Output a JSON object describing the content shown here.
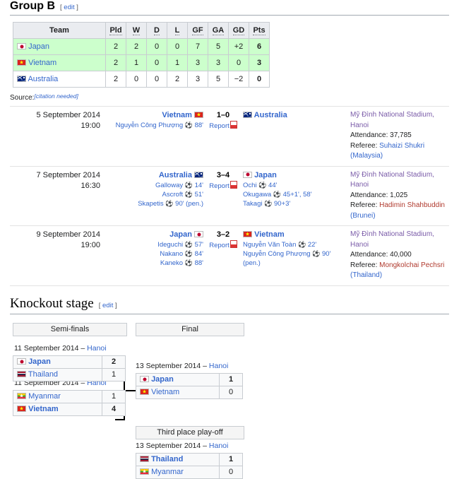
{
  "group": {
    "heading": "Group B",
    "edit": "[ edit ]",
    "edit_label": "edit",
    "columns": [
      "Team",
      "Pld",
      "W",
      "D",
      "L",
      "GF",
      "GA",
      "GD",
      "Pts"
    ],
    "rows": [
      {
        "team": "Japan",
        "flag": "jp",
        "pld": "2",
        "w": "2",
        "d": "0",
        "l": "0",
        "gf": "7",
        "ga": "5",
        "gd": "+2",
        "pts": "6",
        "qualified": true
      },
      {
        "team": "Vietnam",
        "flag": "vn",
        "pld": "2",
        "w": "1",
        "d": "0",
        "l": "1",
        "gf": "3",
        "ga": "3",
        "gd": "0",
        "pts": "3",
        "qualified": true
      },
      {
        "team": "Australia",
        "flag": "au",
        "pld": "2",
        "w": "0",
        "d": "0",
        "l": "2",
        "gf": "3",
        "ga": "5",
        "gd": "−2",
        "pts": "0",
        "qualified": false
      }
    ],
    "source_label": "Source:",
    "citation_needed": "[citation needed]"
  },
  "matches": [
    {
      "date": "5 September 2014",
      "time": "19:00",
      "home": "Vietnam",
      "home_flag": "vn",
      "away": "Australia",
      "away_flag": "au",
      "score": "1–0",
      "home_scorers": "Nguyễn Công Phượng ⚽ 88'",
      "away_scorers": "",
      "report": "Report",
      "venue": "Mỹ Đình National Stadium, Hanoi",
      "attendance": "Attendance: 37,785",
      "referee_label": "Referee:",
      "referee_name": "Suhaizi Shukri",
      "referee_country": "(Malaysia)"
    },
    {
      "date": "7 September 2014",
      "time": "16:30",
      "home": "Australia",
      "home_flag": "au",
      "away": "Japan",
      "away_flag": "jp",
      "score": "3–4",
      "home_scorers": "Galloway ⚽ 14'\nAscroft ⚽ 51'\nSkapetis ⚽ 90' (pen.)",
      "away_scorers": "Ochi ⚽ 44'\nOkugawa ⚽ 45+1', 58'\nTakagi ⚽ 90+3'",
      "report": "Report",
      "venue": "Mỹ Đình National Stadium, Hanoi",
      "attendance": "Attendance: 1,025",
      "referee_label": "Referee:",
      "referee_name": "Hadimin Shahbuddin",
      "referee_country": "(Brunei)"
    },
    {
      "date": "9 September 2014",
      "time": "19:00",
      "home": "Japan",
      "home_flag": "jp",
      "away": "Vietnam",
      "away_flag": "vn",
      "score": "3–2",
      "home_scorers": "Ideguchi ⚽ 57'\nNakano ⚽ 84'\nKaneko ⚽ 88'",
      "away_scorers": "Nguyễn Văn Toàn ⚽ 22'\nNguyễn Công Phượng ⚽ 90' (pen.)",
      "report": "Report",
      "venue": "Mỹ Đình National Stadium, Hanoi",
      "attendance": "Attendance: 40,000",
      "referee_label": "Referee:",
      "referee_name": "Mongkolchai Pechsri",
      "referee_country": "(Thailand)"
    }
  ],
  "knockout": {
    "heading": "Knockout stage",
    "edit": "[ edit ]",
    "edit_label": "edit",
    "round_semi": "Semi-finals",
    "round_final": "Final",
    "round_third": "Third place play-off",
    "sf1": {
      "date": "11 September 2014 – ",
      "location": "Hanoi",
      "top": {
        "team": "Japan",
        "flag": "jp",
        "score": "2",
        "winner": true
      },
      "bottom": {
        "team": "Thailand",
        "flag": "th",
        "score": "1",
        "winner": false
      }
    },
    "sf2": {
      "date": "11 September 2014 – ",
      "location": "Hanoi",
      "top": {
        "team": "Myanmar",
        "flag": "mm",
        "score": "1",
        "winner": false
      },
      "bottom": {
        "team": "Vietnam",
        "flag": "vn",
        "score": "4",
        "winner": true
      }
    },
    "final": {
      "date": "13 September 2014 – ",
      "location": "Hanoi",
      "top": {
        "team": "Japan",
        "flag": "jp",
        "score": "1",
        "winner": true
      },
      "bottom": {
        "team": "Vietnam",
        "flag": "vn",
        "score": "0",
        "winner": false
      }
    },
    "third": {
      "date": "13 September 2014 – ",
      "location": "Hanoi",
      "top": {
        "team": "Thailand",
        "flag": "th",
        "score": "1",
        "winner": true
      },
      "bottom": {
        "team": "Myanmar",
        "flag": "mm",
        "score": "0",
        "winner": false
      }
    }
  },
  "colors": {
    "link": "#3366cc",
    "qualified_bg": "#ccffcc",
    "header_bg": "#eaecf0",
    "border": "#c8ccd1",
    "red_link": "#b03a2e",
    "visited_link": "#7a5ba8"
  }
}
